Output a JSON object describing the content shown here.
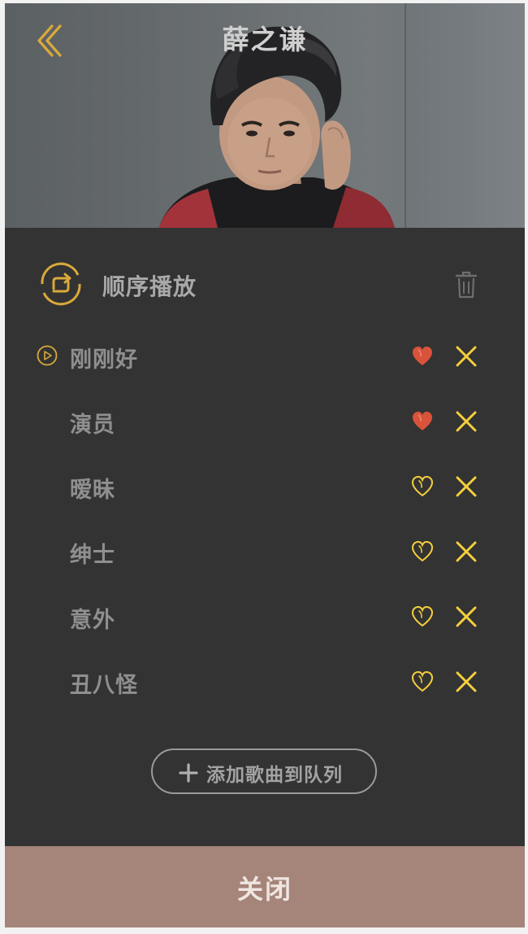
{
  "header": {
    "title": "薛之谦",
    "back_icon": "chevron-left-icon"
  },
  "colors": {
    "accent_gold": "#d9a93a",
    "heart_liked": "#d9533a",
    "heart_outline": "#f5cf3c",
    "remove_x": "#f5cf3c",
    "panel_bg": "#333333",
    "close_bar_bg": "#a58479"
  },
  "play_mode": {
    "label": "顺序播放",
    "icon": "repeat-icon"
  },
  "clear_icon": "trash-icon",
  "playlist": [
    {
      "title": "刚刚好",
      "playing": true,
      "liked": true
    },
    {
      "title": "演员",
      "playing": false,
      "liked": true
    },
    {
      "title": "暧昧",
      "playing": false,
      "liked": false
    },
    {
      "title": "绅士",
      "playing": false,
      "liked": false
    },
    {
      "title": "意外",
      "playing": false,
      "liked": false
    },
    {
      "title": "丑八怪",
      "playing": false,
      "liked": false
    }
  ],
  "add_button": {
    "label": "添加歌曲到队列",
    "icon": "plus-icon"
  },
  "close_button": {
    "label": "关闭"
  }
}
